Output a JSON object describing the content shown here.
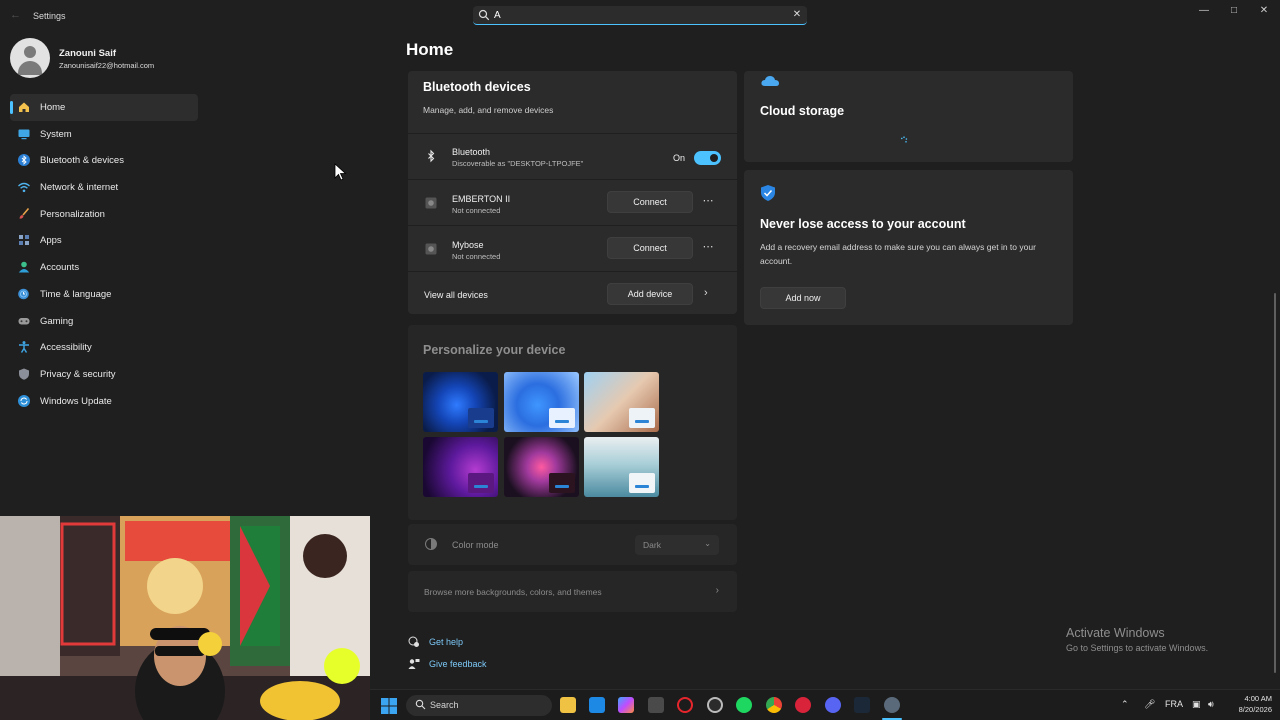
{
  "window": {
    "app_title": "Settings"
  },
  "search": {
    "value": "A",
    "placeholder": ""
  },
  "profile": {
    "name": "Zanouni Saif",
    "email": "Zanounisaif22@hotmail.com"
  },
  "nav": {
    "items": [
      {
        "label": "Home",
        "icon": "home-icon",
        "active": true
      },
      {
        "label": "System",
        "icon": "system-icon"
      },
      {
        "label": "Bluetooth & devices",
        "icon": "bluetooth-icon"
      },
      {
        "label": "Network & internet",
        "icon": "wifi-icon"
      },
      {
        "label": "Personalization",
        "icon": "brush-icon"
      },
      {
        "label": "Apps",
        "icon": "apps-icon"
      },
      {
        "label": "Accounts",
        "icon": "accounts-icon"
      },
      {
        "label": "Time & language",
        "icon": "globe-clock-icon"
      },
      {
        "label": "Gaming",
        "icon": "controller-icon"
      },
      {
        "label": "Accessibility",
        "icon": "accessibility-icon"
      },
      {
        "label": "Privacy & security",
        "icon": "shield-icon"
      },
      {
        "label": "Windows Update",
        "icon": "update-icon"
      }
    ]
  },
  "main": {
    "title": "Home",
    "bluetooth_card": {
      "title": "Bluetooth devices",
      "subtitle": "Manage, add, and remove devices",
      "bluetooth": {
        "name": "Bluetooth",
        "status": "Discoverable as \"DESKTOP-LTPOJFE\"",
        "toggle_label": "On",
        "enabled": true
      },
      "devices": [
        {
          "name": "EMBERTON II",
          "status": "Not connected",
          "action": "Connect"
        },
        {
          "name": "Mybose",
          "status": "Not connected",
          "action": "Connect"
        }
      ],
      "view_all": "View all devices",
      "add_device": "Add device"
    },
    "personalize_card": {
      "title": "Personalize your device",
      "color_mode_label": "Color mode",
      "color_mode_value": "Dark",
      "browse_label": "Browse more backgrounds, colors, and themes"
    },
    "cloud_card": {
      "title": "Cloud storage"
    },
    "account_card": {
      "title": "Never lose access to your account",
      "description": "Add a recovery email address to make sure you can always get in to your account.",
      "button": "Add now"
    },
    "help": {
      "get_help": "Get help",
      "give_feedback": "Give feedback"
    }
  },
  "watermark": {
    "title": "Activate Windows",
    "subtitle": "Go to Settings to activate Windows."
  },
  "taskbar": {
    "search_label": "Search",
    "language": "FRA",
    "time": "4:00 AM",
    "date": "8/20/2026"
  },
  "colors": {
    "accent": "#4cc2ff",
    "background": "#1f1f1f",
    "card": "#2b2b2b"
  }
}
